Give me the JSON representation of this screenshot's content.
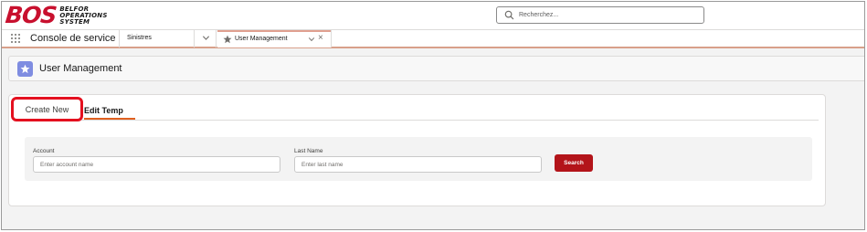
{
  "header": {
    "logo_mark": "BOS",
    "logo_lines": [
      "BELFOR",
      "OPERATIONS",
      "SYSTEM"
    ],
    "search_placeholder": "Recherchez..."
  },
  "nav": {
    "app_name": "Console de service",
    "items": [
      {
        "label": "Sinistres"
      }
    ],
    "active_tab": {
      "label": "User Management"
    }
  },
  "page": {
    "title": "User Management",
    "icon": "star-icon",
    "accent": "#7f8de1"
  },
  "tabs": [
    {
      "label": "Create New",
      "highlighted": true
    },
    {
      "label": "Edit Temp",
      "selected": true
    }
  ],
  "filters": {
    "account": {
      "label": "Account",
      "placeholder": "Enter account name"
    },
    "last_name": {
      "label": "Last Name",
      "placeholder": "Enter last name"
    },
    "search_button": "Search"
  },
  "colors": {
    "brand_red": "#c8102e",
    "button_red": "#b3141a",
    "highlight_red": "#e4101f"
  }
}
